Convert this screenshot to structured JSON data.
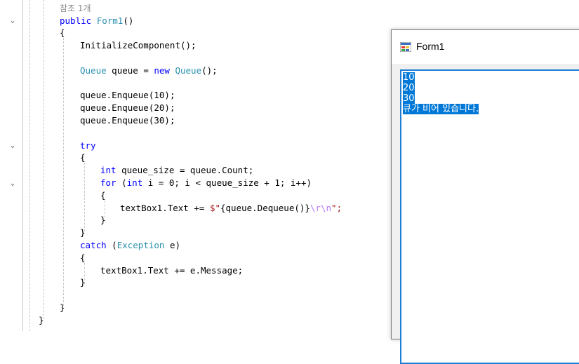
{
  "editor": {
    "ref_count": "참조 1개",
    "code_lines": {
      "l_public": [
        "public",
        " ",
        "Form1",
        "()"
      ],
      "l_init": "InitializeComponent();",
      "l_queue": [
        "Queue",
        " queue = ",
        "new",
        " ",
        "Queue",
        "();"
      ],
      "l_enq1": [
        "queue.Enqueue(",
        "10",
        ");"
      ],
      "l_enq2": [
        "queue.Enqueue(",
        "20",
        ");"
      ],
      "l_enq3": [
        "queue.Enqueue(",
        "30",
        ");"
      ],
      "l_try": "try",
      "l_size": [
        "int",
        " queue_size = queue.Count;"
      ],
      "l_for": [
        "for",
        " (",
        "int",
        " i = 0; i < queue_size + 1; i++)"
      ],
      "l_text": [
        "textBox1.Text += ",
        "$\"",
        "{queue.Dequeue()}",
        "\\r\\n",
        "\";"
      ],
      "l_catch": [
        "catch",
        " (",
        "Exception",
        " e)"
      ],
      "l_msg": "textBox1.Text += e.Message;"
    },
    "braces": {
      "open": "{",
      "close": "}"
    }
  },
  "form_window": {
    "title": "Form1",
    "textbox_lines": [
      "10",
      "20",
      "30",
      "큐가 비어 있습니다."
    ]
  },
  "colors": {
    "keyword": "#0000ff",
    "type": "#2b91af",
    "string": "#a31515",
    "escape": "#b776fb",
    "selection": "#0078d7",
    "textbox_border": "#1e7dd4"
  }
}
